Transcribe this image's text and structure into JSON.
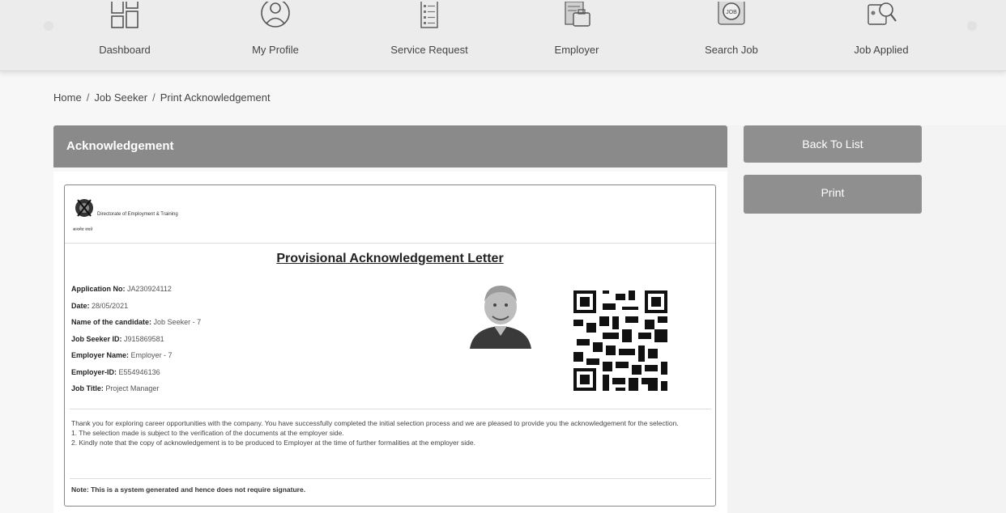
{
  "nav": [
    {
      "label": "Dashboard",
      "icon": "dashboard-icon"
    },
    {
      "label": "My Profile",
      "icon": "profile-icon"
    },
    {
      "label": "Service Request",
      "icon": "service-request-icon"
    },
    {
      "label": "Employer",
      "icon": "employer-icon"
    },
    {
      "label": "Search Job",
      "icon": "search-job-icon"
    },
    {
      "label": "Job Applied",
      "icon": "job-applied-icon"
    }
  ],
  "breadcrumb": [
    "Home",
    "Job Seeker",
    "Print Acknowledgement"
  ],
  "panel": {
    "title": "Acknowledgement"
  },
  "buttons": {
    "back": "Back To List",
    "print": "Print"
  },
  "letter": {
    "org_name": "Directorate of Employment & Training",
    "emblem_text": "सत्यमेव जयते",
    "title": "Provisional Acknowledgement Letter",
    "fields": [
      {
        "label": "Application No:",
        "value": "JA230924112"
      },
      {
        "label": "Date:",
        "value": "28/05/2021"
      },
      {
        "label": "Name of the candidate:",
        "value": "Job Seeker - 7"
      },
      {
        "label": "Job Seeker ID:",
        "value": "J915869581"
      },
      {
        "label": "Employer Name:",
        "value": "Employer - 7"
      },
      {
        "label": "Employer-ID:",
        "value": "E554946136"
      },
      {
        "label": "Job Title:",
        "value": "Project Manager"
      }
    ],
    "paragraph": "Thank you for exploring career opportunities with the company. You have successfully completed the initial selection process and we are pleased to provide you the acknowledgement for the selection.",
    "point1": "1. The selection made is subject to the verification of the documents at the employer side.",
    "point2": "2. Kindly note that the copy of acknowledgement is to be produced to Employer at the time of further formalities at the employer side.",
    "note": "Note: This is a system generated and hence does not require signature."
  },
  "colors": {
    "header_grey": "#8a8a8a",
    "button_grey": "#8f8f8f",
    "nav_bg": "#ececec"
  }
}
